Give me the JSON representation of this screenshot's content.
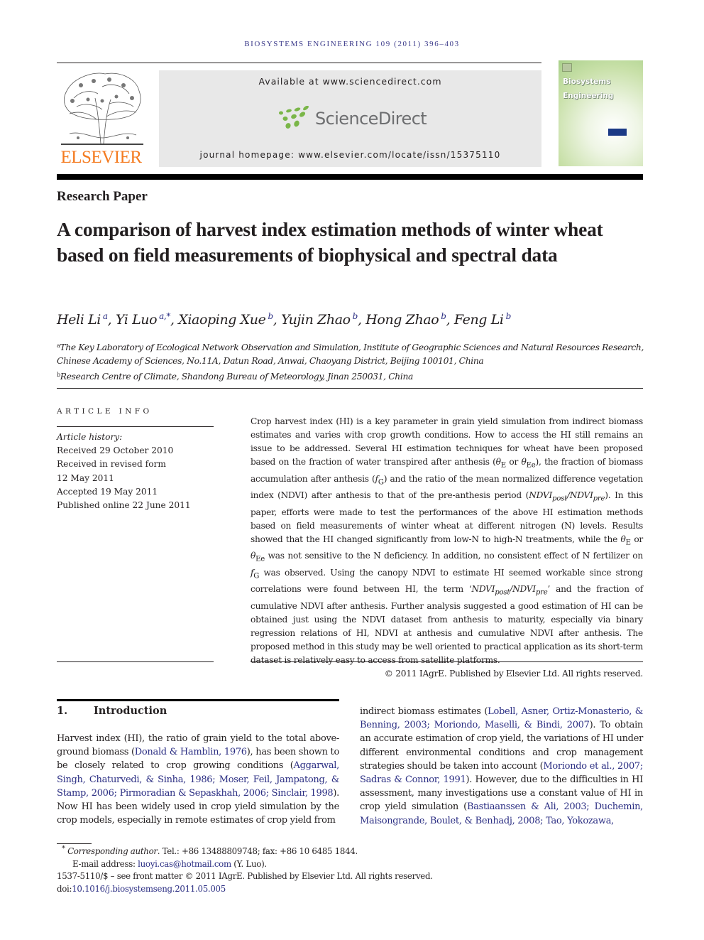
{
  "running_head": "BIOSYSTEMS ENGINEERING 109 (2011) 396–403",
  "masthead": {
    "publisher": "ELSEVIER",
    "available_at": "Available at www.sciencedirect.com",
    "sciencedirect_logo_text": "ScienceDirect",
    "journal_homepage": "journal homepage: www.elsevier.com/locate/issn/15375110",
    "cover_title_line1": "Biosystems",
    "cover_title_line2": "Engineering",
    "colors": {
      "elsevier_orange": "#f47b20",
      "sd_green": "#7ab648",
      "sd_gray": "#6d6e70",
      "link_blue": "#2b2e83"
    }
  },
  "article": {
    "type": "Research Paper",
    "title": "A comparison of harvest index estimation methods of winter wheat based on field measurements of biophysical and spectral data",
    "authors": [
      {
        "name": "Heli Li",
        "aff": "a"
      },
      {
        "name": "Yi Luo",
        "aff": "a,*"
      },
      {
        "name": "Xiaoping Xue",
        "aff": "b"
      },
      {
        "name": "Yujin Zhao",
        "aff": "b"
      },
      {
        "name": "Hong Zhao",
        "aff": "b"
      },
      {
        "name": "Feng Li",
        "aff": "b"
      }
    ],
    "affiliations": [
      {
        "label": "a",
        "text": "The Key Laboratory of Ecological Network Observation and Simulation, Institute of Geographic Sciences and Natural Resources Research, Chinese Academy of Sciences, No.11A, Datun Road, Anwai, Chaoyang District, Beijing 100101, China"
      },
      {
        "label": "b",
        "text": "Research Centre of Climate, Shandong Bureau of Meteorology, Jinan 250031, China"
      }
    ]
  },
  "article_info": {
    "heading": "ARTICLE INFO",
    "history_label": "Article history:",
    "history": [
      "Received 29 October 2010",
      "Received in revised form",
      "12 May 2011",
      "Accepted 19 May 2011",
      "Published online 22 June 2011"
    ]
  },
  "abstract": {
    "p1": "Crop harvest index (HI) is a key parameter in grain yield simulation from indirect biomass estimates and varies with crop growth conditions. How to access the HI still remains an issue to be addressed. Several HI estimation techniques for wheat have been proposed based on the fraction of water transpired after anthesis (",
    "sym_thetaE": "θ",
    "sub_E": "E",
    "or1": " or ",
    "sub_Ee": "Ee",
    "p2": "), the fraction of biomass accumulation after anthesis (",
    "sym_f": "f",
    "sub_G": "G",
    "p3": ") and the ratio of the mean normalized difference vegetation index (NDVI) after anthesis to that of the pre-anthesis period (",
    "ndvi": "NDVI",
    "sub_post": "post",
    "slash": "/",
    "sub_pre": "pre",
    "p4": "). In this paper, efforts were made to test the performances of the above HI estimation methods based on field measurements of winter wheat at different nitrogen (N) levels. Results showed that the HI changed significantly from low-N to high-N treatments, while the ",
    "p5": " was not sensitive to the N deficiency. In addition, no consistent effect of N fertilizer on ",
    "p6": " was observed. Using the canopy NDVI to estimate HI seemed workable since strong correlations were found between HI, the term ‘",
    "p7": "’ and the fraction of cumulative NDVI after anthesis. Further analysis suggested a good estimation of HI can be obtained just using the NDVI dataset from anthesis to maturity, especially via binary regression relations of HI, NDVI at anthesis and cumulative NDVI after anthesis. The proposed method in this study may be well oriented to practical application as its short-term dataset is relatively easy to access from satellite platforms.",
    "copyright": "© 2011 IAgrE. Published by Elsevier Ltd. All rights reserved."
  },
  "introduction": {
    "number": "1.",
    "heading": "Introduction",
    "left": {
      "t1": "Harvest index (HI), the ratio of grain yield to the total above-ground biomass (",
      "c1": "Donald & Hamblin, 1976",
      "t2": "), has been shown to be closely related to crop growing conditions (",
      "c2": "Aggarwal, Singh, Chaturvedi, & Sinha, 1986",
      "s1": "; ",
      "c3": "Moser, Feil, Jampatong, & Stamp, 2006",
      "s2": "; ",
      "c4": "Pirmoradian & Sepaskhah, 2006",
      "s3": "; ",
      "c5": "Sinclair, 1998",
      "t3": "). Now HI has been widely used in crop yield simulation by the crop models, especially in remote estimates of crop yield from"
    },
    "right": {
      "t1": "indirect biomass estimates (",
      "c1": "Lobell, Asner, Ortiz-Monasterio, & Benning, 2003",
      "s1": "; ",
      "c2": "Moriondo, Maselli, & Bindi, 2007",
      "t2": "). To obtain an accurate estimation of crop yield, the variations of HI under different environmental conditions and crop management strategies should be taken into account (",
      "c3": "Moriondo et al., 2007",
      "s2": "; ",
      "c4": "Sadras & Connor, 1991",
      "t3": "). However, due to the difficulties in HI assessment, many investigations use a constant value of HI in crop yield simulation (",
      "c5": "Bastiaanssen & Ali, 2003",
      "s3": "; ",
      "c6": "Duchemin, Maisongrande, Boulet, & Benhadj, 2008",
      "s4": "; ",
      "c7": "Tao, Yokozawa,"
    }
  },
  "footnotes": {
    "star": "*",
    "corr_label": "Corresponding author",
    "corr_contact": ". Tel.: +86 13488809748; fax: +86 10 6485 1844.",
    "email_label": "E-mail address: ",
    "email": "luoyi.cas@hotmail.com",
    "email_owner": " (Y. Luo).",
    "front_matter": "1537-5110/$ – see front matter © 2011 IAgrE. Published by Elsevier Ltd. All rights reserved.",
    "doi_label": "doi:",
    "doi": "10.1016/j.biosystemseng.2011.05.005"
  }
}
